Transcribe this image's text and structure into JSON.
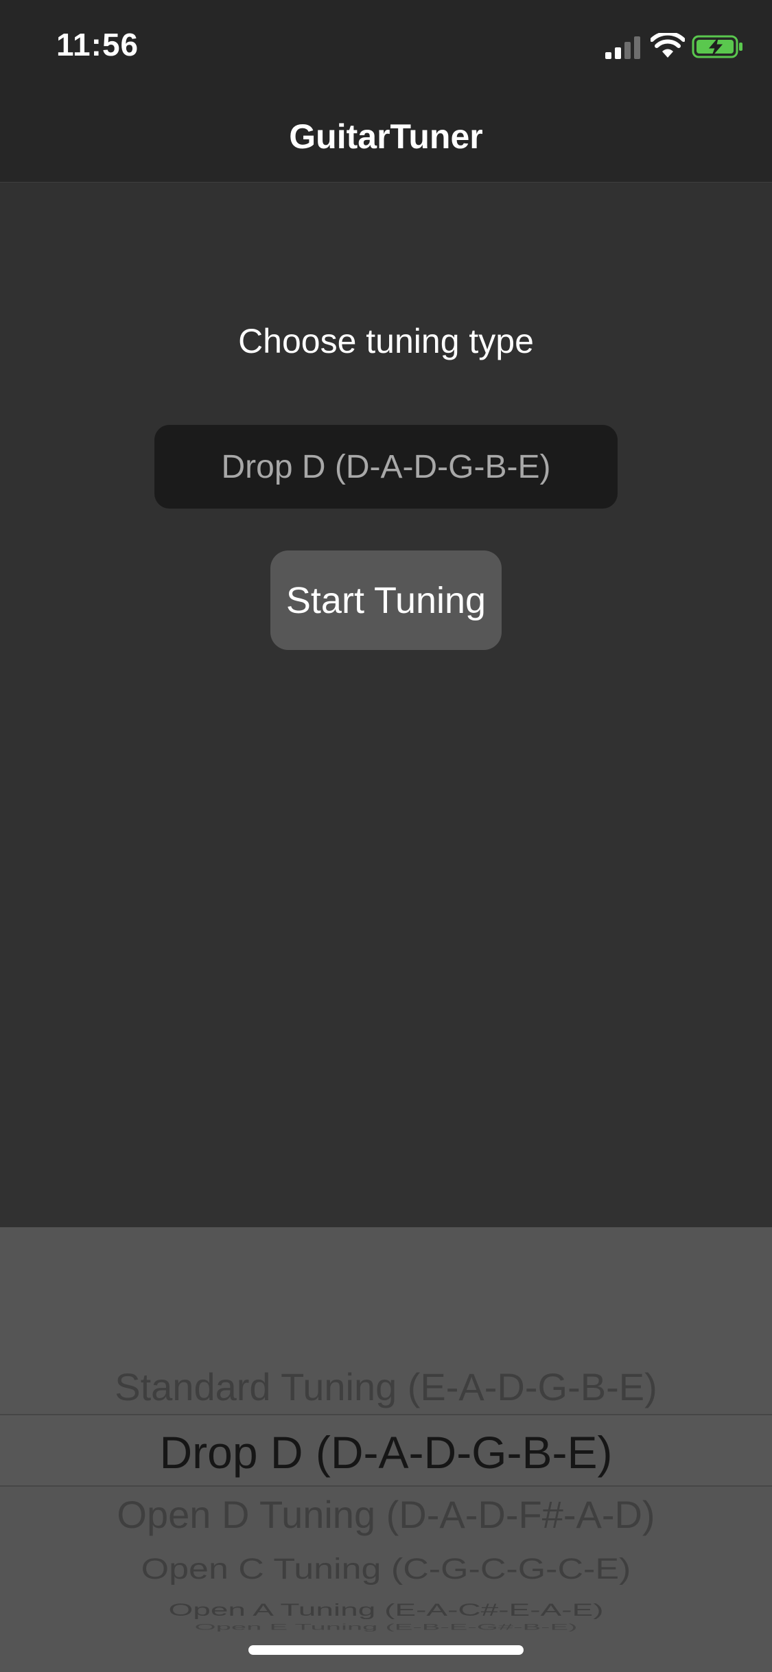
{
  "status_bar": {
    "time": "11:56",
    "icons": [
      "signal-icon",
      "wifi-icon",
      "battery-charging-icon"
    ],
    "battery_color": "#5ac84e"
  },
  "nav": {
    "title": "GuitarTuner"
  },
  "main": {
    "prompt": "Choose tuning type",
    "tuning_field": {
      "value": "Drop D (D-A-D-G-B-E)"
    },
    "start_button_label": "Start Tuning"
  },
  "picker": {
    "selected_index": 1,
    "options": [
      "Standard Tuning (E-A-D-G-B-E)",
      "Drop D (D-A-D-G-B-E)",
      "Open D Tuning (D-A-D-F#-A-D)",
      "Open C Tuning (C-G-C-G-C-E)",
      "Open A Tuning (E-A-C#-E-A-E)",
      "Open E Tuning (E-B-E-G#-B-E)"
    ]
  },
  "colors": {
    "background": "#313131",
    "bar_background": "#262626",
    "picker_background": "#555555",
    "field_background": "#1b1b1b",
    "button_background": "#575757"
  }
}
